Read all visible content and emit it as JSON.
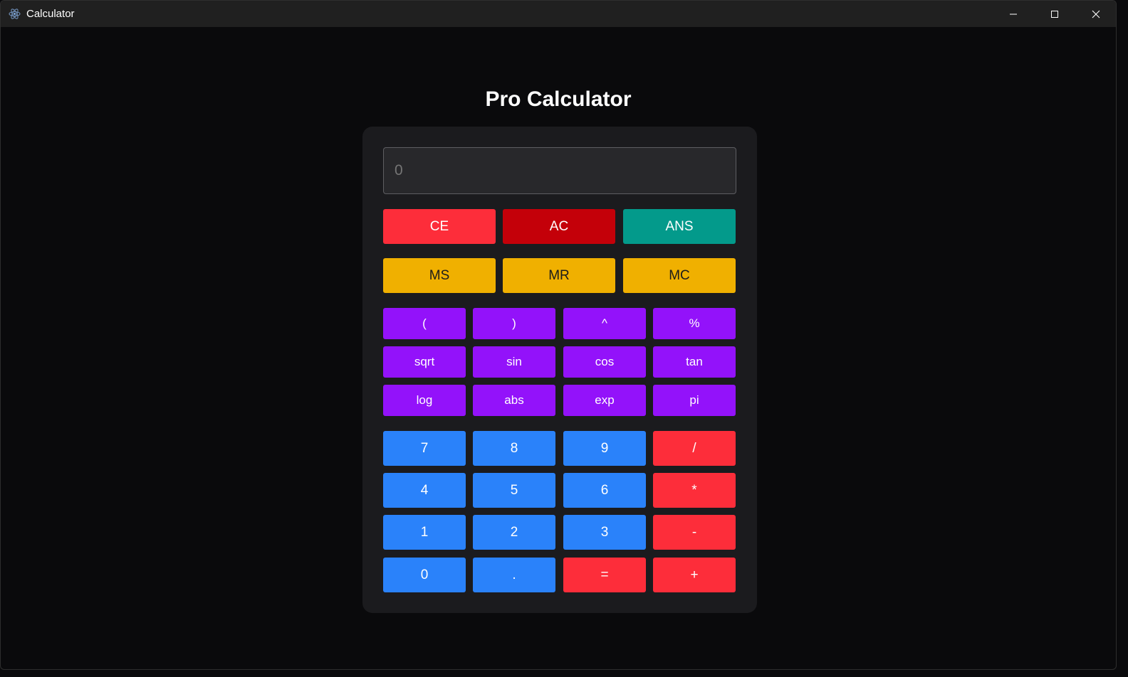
{
  "window": {
    "title": "Calculator",
    "icon": "atom-app-icon",
    "controls": [
      "minimize-icon",
      "maximize-icon",
      "close-icon"
    ]
  },
  "page": {
    "heading": "Pro Calculator"
  },
  "display": {
    "placeholder": "0",
    "value": ""
  },
  "control_row": [
    {
      "label": "CE",
      "color": "#fd2d3a"
    },
    {
      "label": "AC",
      "color": "#c40009"
    },
    {
      "label": "ANS",
      "color": "#039a8b"
    }
  ],
  "memory_row": [
    {
      "label": "MS",
      "color": "#f0b000"
    },
    {
      "label": "MR",
      "color": "#f0b000"
    },
    {
      "label": "MC",
      "color": "#f0b000"
    }
  ],
  "function_rows": [
    [
      "(",
      ")",
      "^",
      "%"
    ],
    [
      "sqrt",
      "sin",
      "cos",
      "tan"
    ],
    [
      "log",
      "abs",
      "exp",
      "pi"
    ]
  ],
  "keypad_rows": [
    [
      "7",
      "8",
      "9",
      "/"
    ],
    [
      "4",
      "5",
      "6",
      "*"
    ],
    [
      "1",
      "2",
      "3",
      "-"
    ],
    [
      "0",
      ".",
      "=",
      "+"
    ]
  ],
  "colors": {
    "background": "#0a0a0c",
    "card": "#1b1b1e",
    "function": "#9312fa",
    "digit": "#2a82fa",
    "operator": "#fd2d3a"
  }
}
